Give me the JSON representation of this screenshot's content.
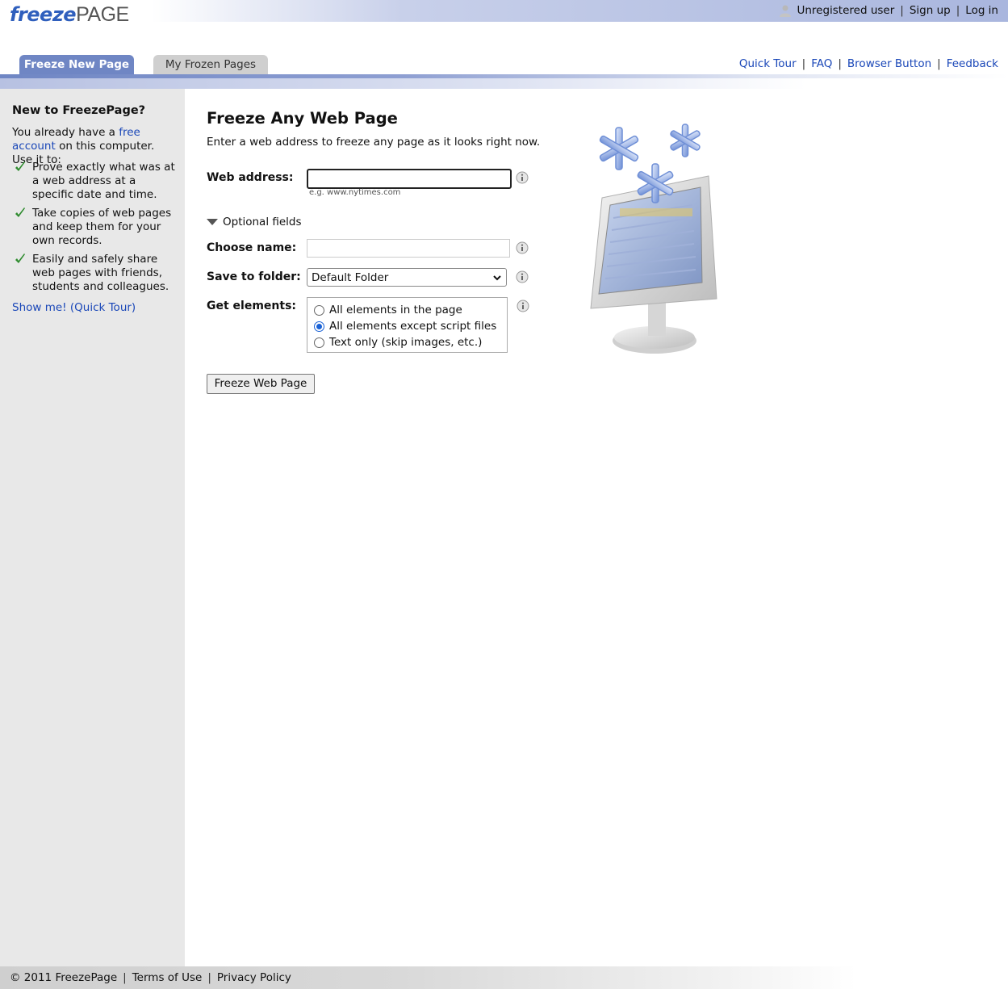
{
  "logo": {
    "part1": "freeze",
    "part2": "PAGE"
  },
  "userbar": {
    "user": "Unregistered user",
    "signup": "Sign up",
    "login": "Log in"
  },
  "tabs": [
    {
      "label": "Freeze New Page",
      "active": true
    },
    {
      "label": "My Frozen Pages",
      "active": false
    }
  ],
  "toplinks": [
    "Quick Tour",
    "FAQ",
    "Browser Button",
    "Feedback"
  ],
  "sidebar": {
    "title": "New to FreezePage?",
    "intro_before": "You already have a ",
    "intro_link": "free account",
    "intro_after": " on this computer. Use it to:",
    "items": [
      "Prove exactly what was at a web address at a specific date and time.",
      "Take copies of web pages and keep them for your own records.",
      "Easily and safely share web pages with friends, students and colleagues."
    ],
    "showme": "Show me! (Quick Tour)"
  },
  "main": {
    "title": "Freeze Any Web Page",
    "description": "Enter a web address to freeze any page as it looks right now.",
    "web_address_label": "Web address:",
    "web_address_value": "",
    "web_address_example": "e.g. www.nytimes.com",
    "optional_fields": "Optional fields",
    "choose_name_label": "Choose name:",
    "choose_name_value": "",
    "folder_label": "Save to folder:",
    "folder_value": "Default Folder",
    "elements_label": "Get elements:",
    "elements_options": [
      {
        "label": "All elements in the page",
        "selected": false
      },
      {
        "label": "All elements except script files",
        "selected": true
      },
      {
        "label": "Text only (skip images, etc.)",
        "selected": false
      }
    ],
    "submit": "Freeze Web Page"
  },
  "footer": {
    "copyright": "© 2011 FreezePage",
    "terms": "Terms of Use",
    "privacy": "Privacy Policy"
  },
  "colors": {
    "accent": "#6f86c4",
    "link": "#1a47b8",
    "check": "#2e8b2e"
  }
}
